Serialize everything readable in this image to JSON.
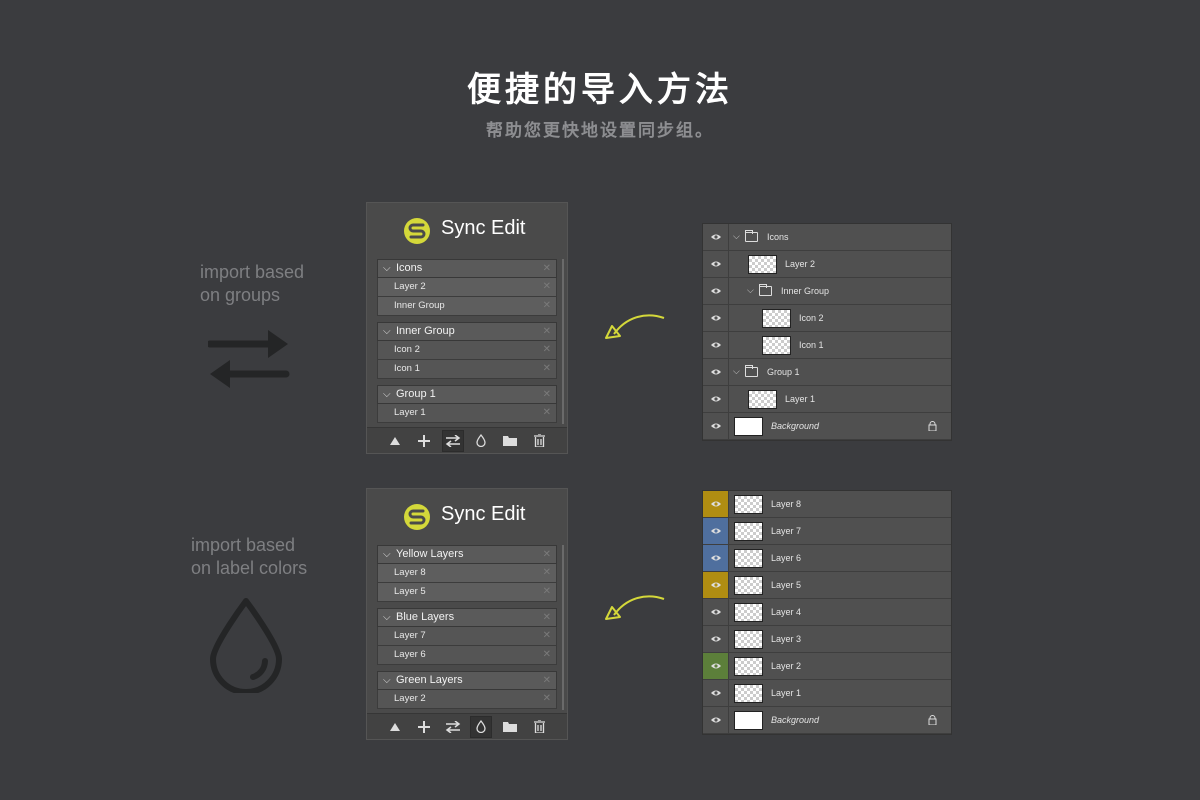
{
  "hero": {
    "title": "便捷的导入方法",
    "subtitle": "帮助您更快地设置同步组。"
  },
  "section_groups": {
    "caption_line1": "import based",
    "caption_line2": "on groups"
  },
  "section_colors": {
    "caption_line1": "import based",
    "caption_line2": "on label colors"
  },
  "panel1": {
    "title": "Sync Edit",
    "groups": [
      {
        "name": "Icons",
        "items": [
          "Layer 2",
          "Inner Group"
        ]
      },
      {
        "name": "Inner Group",
        "items": [
          "Icon 2",
          "Icon 1"
        ]
      },
      {
        "name": "Group 1",
        "items": [
          "Layer 1"
        ]
      }
    ],
    "close_glyph": "✕"
  },
  "panel2": {
    "title": "Sync Edit",
    "groups": [
      {
        "name": "Yellow Layers",
        "items": [
          "Layer 8",
          "Layer 5"
        ]
      },
      {
        "name": "Blue Layers",
        "items": [
          "Layer 7",
          "Layer 6"
        ]
      },
      {
        "name": "Green Layers",
        "items": [
          "Layer 2"
        ]
      }
    ]
  },
  "layers1": [
    {
      "name": "Icons",
      "type": "group"
    },
    {
      "name": "Layer 2",
      "type": "layer"
    },
    {
      "name": "Inner Group",
      "type": "group"
    },
    {
      "name": "Icon 2",
      "type": "layer"
    },
    {
      "name": "Icon 1",
      "type": "layer"
    },
    {
      "name": "Group 1",
      "type": "group"
    },
    {
      "name": "Layer 1",
      "type": "layer"
    },
    {
      "name": "Background",
      "type": "bg"
    }
  ],
  "layers2": [
    {
      "name": "Layer 8",
      "label": "yellow"
    },
    {
      "name": "Layer 7",
      "label": "blue"
    },
    {
      "name": "Layer 6",
      "label": "blue"
    },
    {
      "name": "Layer 5",
      "label": "yellow"
    },
    {
      "name": "Layer 4",
      "label": "none"
    },
    {
      "name": "Layer 3",
      "label": "none"
    },
    {
      "name": "Layer 2",
      "label": "green"
    },
    {
      "name": "Layer 1",
      "label": "none"
    },
    {
      "name": "Background",
      "label": "none"
    }
  ],
  "colors": {
    "accent": "#d4d83a",
    "yellow": "#b08d12",
    "blue": "#4f6f9e",
    "green": "#5c7f3a",
    "background": "#3b3c3f",
    "icon_dark": "#242526"
  },
  "icons": {
    "logo": "sync-edit-logo",
    "toolbar": [
      "triangle-up-icon",
      "plus-icon",
      "swap-icon",
      "drop-icon",
      "folder-icon",
      "trash-icon"
    ]
  }
}
